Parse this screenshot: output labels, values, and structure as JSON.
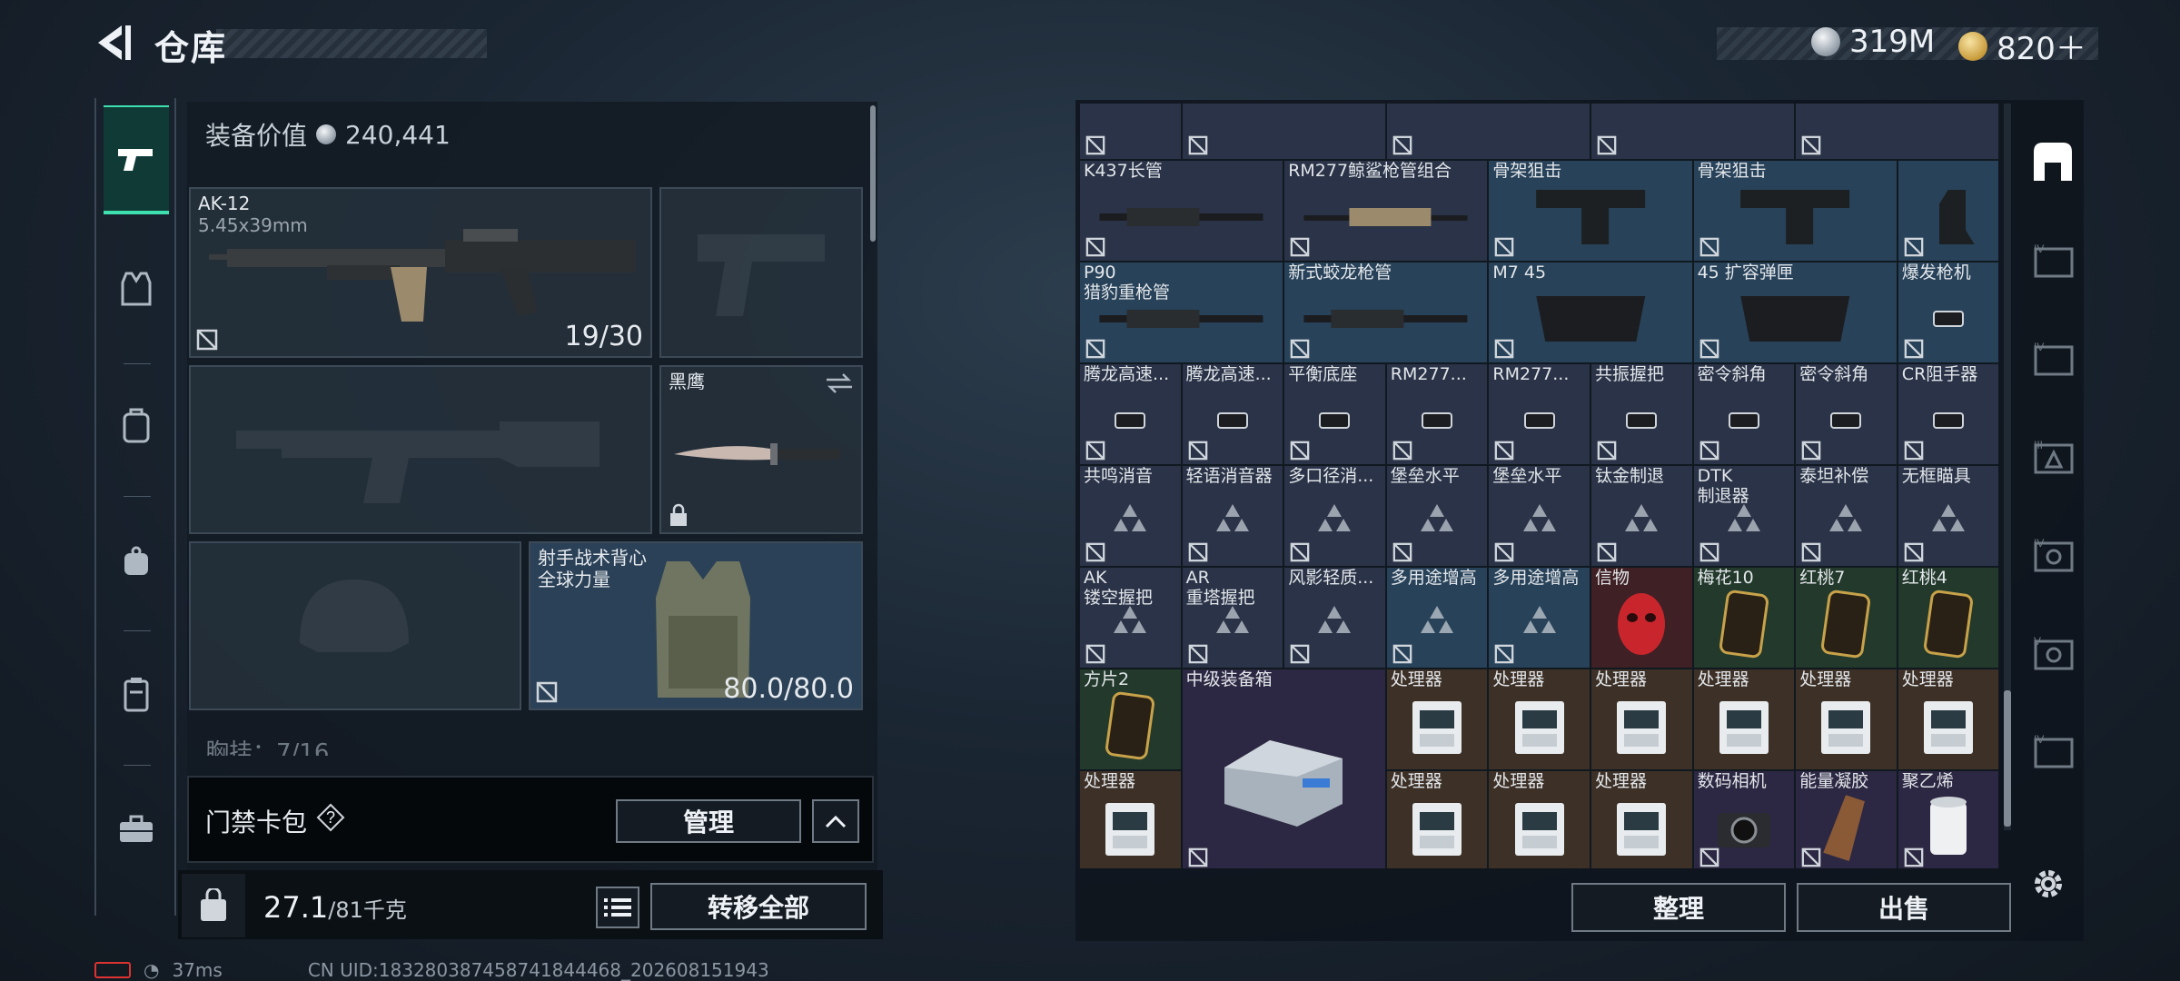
{
  "header": {
    "title": "仓库"
  },
  "currency": [
    {
      "icon": "silver-coin-icon",
      "value": "319M"
    },
    {
      "icon": "gold-coin-icon",
      "value": "820＋"
    }
  ],
  "left_nav": [
    "gun-icon",
    "vest-icon",
    "backpack-icon",
    "pouch-icon",
    "locker-icon",
    "toolbox-icon"
  ],
  "equipment": {
    "value_label": "装备价值",
    "value": "240,441",
    "primary": {
      "name": "AK-12",
      "caliber": "5.45x39mm",
      "ammo": "19/30"
    },
    "melee": {
      "name": "黑鹰"
    },
    "armor": {
      "name": "射手战术背心\n全球力量",
      "durability": "80.0/80.0"
    },
    "chest_rig_hint": "胸挂：7/16"
  },
  "card_pack": {
    "label": "门禁卡包",
    "manage_label": "管理"
  },
  "bottom": {
    "weight_current": "27.1",
    "weight_max": "/81千克",
    "transfer_all": "转移全部"
  },
  "storage": {
    "cells": [
      {
        "c": 0,
        "r": 0,
        "w": 1,
        "h": 1,
        "name": "",
        "bg": "c-navy"
      },
      {
        "c": 1,
        "r": 0,
        "w": 2,
        "h": 1,
        "name": "",
        "bg": "c-navy"
      },
      {
        "c": 3,
        "r": 0,
        "w": 2,
        "h": 1,
        "name": "",
        "bg": "c-navy"
      },
      {
        "c": 5,
        "r": 0,
        "w": 2,
        "h": 1,
        "name": "",
        "bg": "c-navy"
      },
      {
        "c": 7,
        "r": 0,
        "w": 2,
        "h": 1,
        "name": "",
        "bg": "c-navy"
      },
      {
        "c": 9,
        "r": 0,
        "w": 1,
        "h": 1,
        "name": "",
        "bg": "c-navy"
      },
      {
        "c": 0,
        "r": 1,
        "w": 2,
        "h": 1,
        "name": "K437长管",
        "bg": "c-navy",
        "img": "barrel"
      },
      {
        "c": 2,
        "r": 1,
        "w": 2,
        "h": 1,
        "name": "RM277鲸鲨枪管组合",
        "bg": "c-navy",
        "img": "barrel2"
      },
      {
        "c": 4,
        "r": 1,
        "w": 2,
        "h": 1,
        "name": "骨架狙击",
        "bg": "c-blue",
        "img": "stock"
      },
      {
        "c": 6,
        "r": 1,
        "w": 2,
        "h": 1,
        "name": "骨架狙击",
        "bg": "c-blue",
        "img": "stock"
      },
      {
        "c": 8,
        "r": 1,
        "w": 1,
        "h": 1,
        "name": "",
        "bg": "c-blue",
        "img": "stock2"
      },
      {
        "c": 0,
        "r": 2,
        "w": 2,
        "h": 1,
        "name": "P90\n猎豹重枪管",
        "bg": "c-blue",
        "img": "barrel"
      },
      {
        "c": 2,
        "r": 2,
        "w": 2,
        "h": 1,
        "name": "新式蛟龙枪管",
        "bg": "c-blue",
        "img": "barrel"
      },
      {
        "c": 4,
        "r": 2,
        "w": 2,
        "h": 1,
        "name": "M7 45",
        "bg": "c-blue",
        "img": "mag"
      },
      {
        "c": 6,
        "r": 2,
        "w": 2,
        "h": 1,
        "name": "45 扩容弹匣",
        "bg": "c-blue",
        "img": "mag"
      },
      {
        "c": 8,
        "r": 2,
        "w": 1,
        "h": 1,
        "name": "爆发枪机",
        "bg": "c-blue",
        "img": "small"
      },
      {
        "c": 0,
        "r": 3,
        "w": 1,
        "h": 1,
        "name": "腾龙高速...",
        "bg": "c-navy",
        "img": "small"
      },
      {
        "c": 1,
        "r": 3,
        "w": 1,
        "h": 1,
        "name": "腾龙高速...",
        "bg": "c-navy",
        "img": "small"
      },
      {
        "c": 2,
        "r": 3,
        "w": 1,
        "h": 1,
        "name": "平衡底座",
        "bg": "c-navy",
        "img": "small"
      },
      {
        "c": 3,
        "r": 3,
        "w": 1,
        "h": 1,
        "name": "RM277...",
        "bg": "c-navy",
        "img": "small"
      },
      {
        "c": 4,
        "r": 3,
        "w": 1,
        "h": 1,
        "name": "RM277...",
        "bg": "c-navy",
        "img": "small"
      },
      {
        "c": 5,
        "r": 3,
        "w": 1,
        "h": 1,
        "name": "共振握把",
        "bg": "c-navy",
        "img": "small"
      },
      {
        "c": 6,
        "r": 3,
        "w": 1,
        "h": 1,
        "name": "密令斜角",
        "bg": "c-navy",
        "img": "small"
      },
      {
        "c": 7,
        "r": 3,
        "w": 1,
        "h": 1,
        "name": "密令斜角",
        "bg": "c-navy",
        "img": "small"
      },
      {
        "c": 8,
        "r": 3,
        "w": 1,
        "h": 1,
        "name": "CR阻手器",
        "bg": "c-navy",
        "img": "small"
      },
      {
        "c": 0,
        "r": 4,
        "w": 1,
        "h": 1,
        "name": "共鸣消音",
        "bg": "c-navy",
        "img": "tri"
      },
      {
        "c": 1,
        "r": 4,
        "w": 1,
        "h": 1,
        "name": "轻语消音器",
        "bg": "c-navy",
        "img": "tri"
      },
      {
        "c": 2,
        "r": 4,
        "w": 1,
        "h": 1,
        "name": "多口径消...",
        "bg": "c-navy",
        "img": "tri"
      },
      {
        "c": 3,
        "r": 4,
        "w": 1,
        "h": 1,
        "name": "堡垒水平",
        "bg": "c-navy",
        "img": "tri"
      },
      {
        "c": 4,
        "r": 4,
        "w": 1,
        "h": 1,
        "name": "堡垒水平",
        "bg": "c-navy",
        "img": "tri"
      },
      {
        "c": 5,
        "r": 4,
        "w": 1,
        "h": 1,
        "name": "钛金制退",
        "bg": "c-navy",
        "img": "tri"
      },
      {
        "c": 6,
        "r": 4,
        "w": 1,
        "h": 1,
        "name": "DTK\n制退器",
        "bg": "c-navy",
        "img": "tri"
      },
      {
        "c": 7,
        "r": 4,
        "w": 1,
        "h": 1,
        "name": "泰坦补偿",
        "bg": "c-navy",
        "img": "tri"
      },
      {
        "c": 8,
        "r": 4,
        "w": 1,
        "h": 1,
        "name": "无框瞄具",
        "bg": "c-navy",
        "img": "tri"
      },
      {
        "c": 0,
        "r": 5,
        "w": 1,
        "h": 1,
        "name": "AK\n镂空握把",
        "bg": "c-navy",
        "img": "tri"
      },
      {
        "c": 1,
        "r": 5,
        "w": 1,
        "h": 1,
        "name": "AR\n重塔握把",
        "bg": "c-navy",
        "img": "tri"
      },
      {
        "c": 2,
        "r": 5,
        "w": 1,
        "h": 1,
        "name": "风影轻质...",
        "bg": "c-navy",
        "img": "tri"
      },
      {
        "c": 3,
        "r": 5,
        "w": 1,
        "h": 1,
        "name": "多用途增高",
        "bg": "c-blue",
        "img": "tri"
      },
      {
        "c": 4,
        "r": 5,
        "w": 1,
        "h": 1,
        "name": "多用途增高",
        "bg": "c-blue",
        "img": "tri"
      },
      {
        "c": 5,
        "r": 5,
        "w": 1,
        "h": 1,
        "name": "信物",
        "bg": "c-red",
        "img": "mask"
      },
      {
        "c": 6,
        "r": 5,
        "w": 1,
        "h": 1,
        "name": "梅花10",
        "bg": "c-green",
        "img": "card"
      },
      {
        "c": 7,
        "r": 5,
        "w": 1,
        "h": 1,
        "name": "红桃7",
        "bg": "c-green",
        "img": "card"
      },
      {
        "c": 8,
        "r": 5,
        "w": 1,
        "h": 1,
        "name": "红桃4",
        "bg": "c-green",
        "img": "card"
      },
      {
        "c": 0,
        "r": 6,
        "w": 1,
        "h": 1,
        "name": "方片2",
        "bg": "c-green",
        "img": "card"
      },
      {
        "c": 1,
        "r": 6,
        "w": 2,
        "h": 2,
        "name": "中级装备箱",
        "bg": "c-purple",
        "img": "box"
      },
      {
        "c": 3,
        "r": 6,
        "w": 1,
        "h": 1,
        "name": "处理器",
        "bg": "c-brown",
        "img": "cpu"
      },
      {
        "c": 4,
        "r": 6,
        "w": 1,
        "h": 1,
        "name": "处理器",
        "bg": "c-brown",
        "img": "cpu"
      },
      {
        "c": 5,
        "r": 6,
        "w": 1,
        "h": 1,
        "name": "处理器",
        "bg": "c-brown",
        "img": "cpu"
      },
      {
        "c": 6,
        "r": 6,
        "w": 1,
        "h": 1,
        "name": "处理器",
        "bg": "c-brown",
        "img": "cpu"
      },
      {
        "c": 7,
        "r": 6,
        "w": 1,
        "h": 1,
        "name": "处理器",
        "bg": "c-brown",
        "img": "cpu"
      },
      {
        "c": 8,
        "r": 6,
        "w": 1,
        "h": 1,
        "name": "处理器",
        "bg": "c-brown",
        "img": "cpu"
      },
      {
        "c": 0,
        "r": 7,
        "w": 1,
        "h": 1,
        "name": "处理器",
        "bg": "c-brown",
        "img": "cpu"
      },
      {
        "c": 3,
        "r": 7,
        "w": 1,
        "h": 1,
        "name": "处理器",
        "bg": "c-brown",
        "img": "cpu"
      },
      {
        "c": 4,
        "r": 7,
        "w": 1,
        "h": 1,
        "name": "处理器",
        "bg": "c-brown",
        "img": "cpu"
      },
      {
        "c": 5,
        "r": 7,
        "w": 1,
        "h": 1,
        "name": "处理器",
        "bg": "c-brown",
        "img": "cpu"
      },
      {
        "c": 6,
        "r": 7,
        "w": 1,
        "h": 1,
        "name": "数码相机",
        "bg": "c-purple",
        "img": "camera"
      },
      {
        "c": 7,
        "r": 7,
        "w": 1,
        "h": 1,
        "name": "能量凝胶",
        "bg": "c-purple",
        "img": "gel"
      },
      {
        "c": 8,
        "r": 7,
        "w": 1,
        "h": 1,
        "name": "聚乙烯",
        "bg": "c-purple",
        "img": "roll"
      }
    ],
    "sort_label": "整理",
    "sell_label": "出售"
  },
  "right_nav": [
    "safe-box-icon",
    "case-tier-4-icon",
    "case-tier-4-icon",
    "case-tier-3-icon",
    "case-tier-4-icon",
    "case-tier-5-icon",
    "case-tier-4-icon"
  ],
  "status": {
    "ping": "37ms",
    "uid": "CN UID:18328038745874184446​8_202608151943"
  },
  "colors": {
    "accent": "#3fe0b0",
    "bg": "#1b2633"
  }
}
